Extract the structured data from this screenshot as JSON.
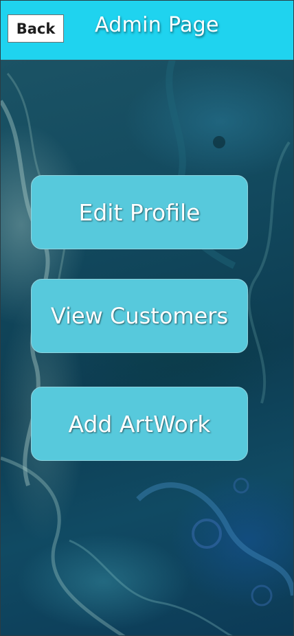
{
  "header": {
    "back_label": "Back",
    "title": "Admin Page",
    "background_color": "#1fd3ef"
  },
  "menu": {
    "items": [
      {
        "label": "Edit Profile"
      },
      {
        "label": "View Customers"
      },
      {
        "label": "Add ArtWork"
      }
    ],
    "button_color": "#57c9dc"
  }
}
